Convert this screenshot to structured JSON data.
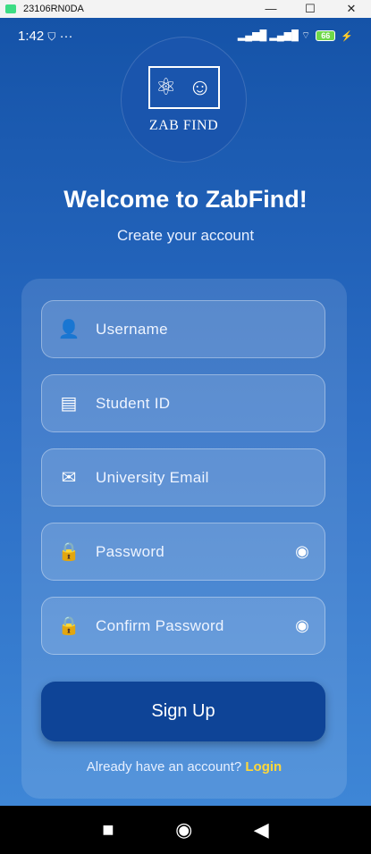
{
  "window": {
    "title": "23106RN0DA",
    "minimize": "—",
    "maximize": "☐",
    "close": "✕"
  },
  "status": {
    "time": "1:42",
    "battery": "66",
    "signal": "▂▄▆█ ▂▄▆█ ⌔",
    "charging": "⚡",
    "dots": "···",
    "vpn": "⛉"
  },
  "logo": {
    "text": "ZAB FIND"
  },
  "header": {
    "title": "Welcome to ZabFind!",
    "subtitle": "Create your account"
  },
  "form": {
    "fields": [
      {
        "label": "Username",
        "icon": "account-circle-icon",
        "glyph": "👤"
      },
      {
        "label": "Student ID",
        "icon": "badge-icon",
        "glyph": "▤"
      },
      {
        "label": "University Email",
        "icon": "email-icon",
        "glyph": "✉"
      },
      {
        "label": "Password",
        "icon": "lock-icon",
        "glyph": "🔒",
        "toggle": "◉"
      },
      {
        "label": "Confirm Password",
        "icon": "lock-icon",
        "glyph": "🔒",
        "toggle": "◉"
      }
    ],
    "submit": "Sign Up",
    "login_prompt": "Already have an account?",
    "login_link": "Login"
  },
  "nav": {
    "recents": "■",
    "home": "◉",
    "back": "◀"
  }
}
